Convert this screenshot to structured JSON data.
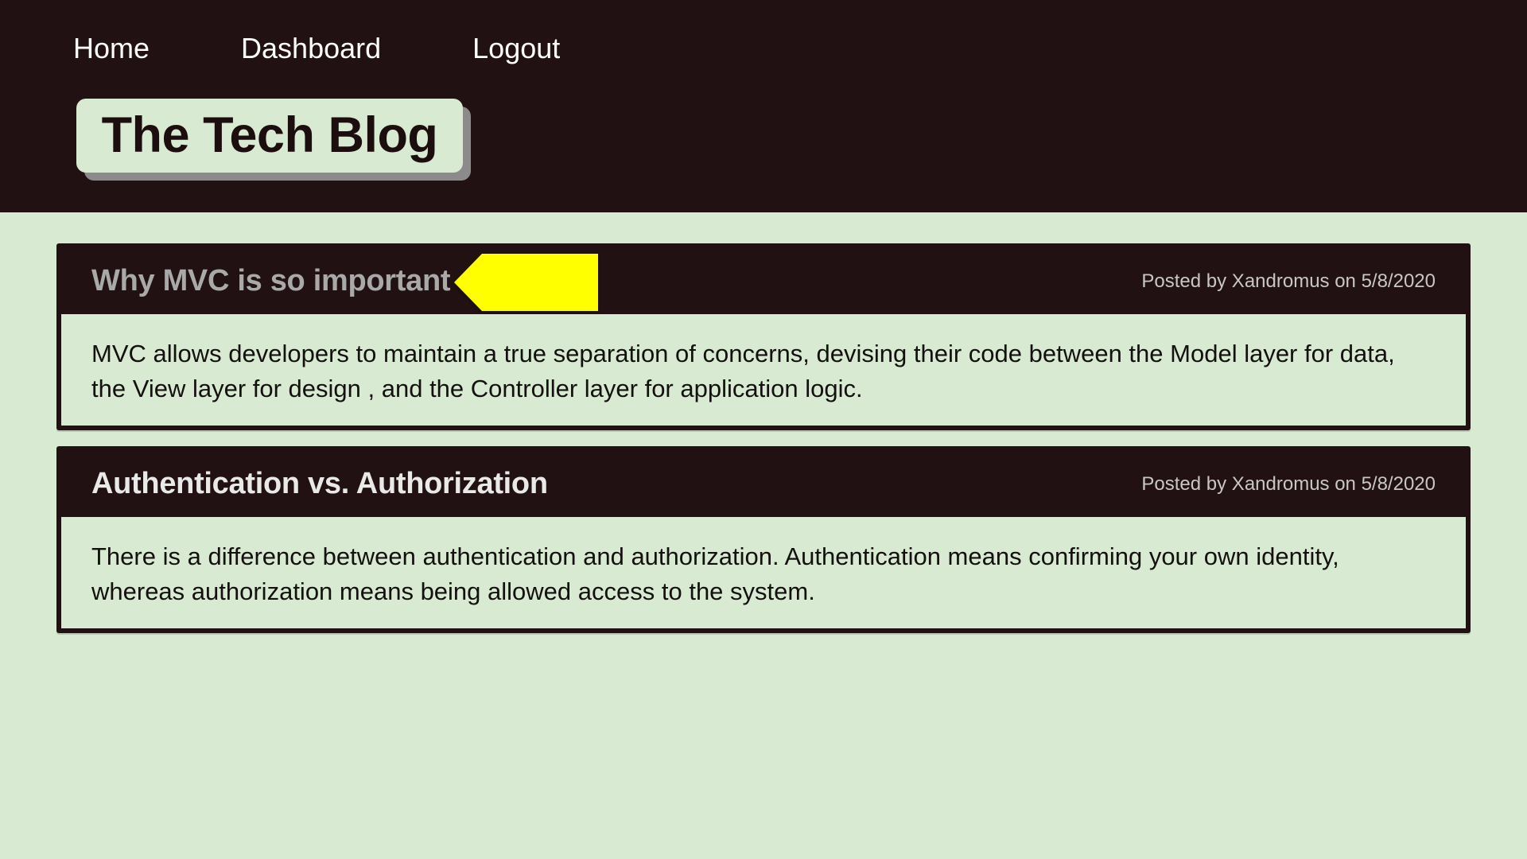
{
  "nav": {
    "items": [
      "Home",
      "Dashboard",
      "Logout"
    ]
  },
  "brand": {
    "title": "The Tech Blog"
  },
  "posts": [
    {
      "title": "Why MVC is so important",
      "meta": "Posted by Xandromus on 5/8/2020",
      "body": "MVC allows developers to maintain a true separation of concerns, devising their code between the Model layer for data, the View layer for design , and the Controller layer for application logic."
    },
    {
      "title": "Authentication vs. Authorization",
      "meta": "Posted by Xandromus on 5/8/2020",
      "body": "There is a difference between authentication and authorization. Authentication means confirming your own identity, whereas authorization means being allowed access to the system."
    }
  ],
  "colors": {
    "background": "#d8ead1",
    "header": "#221112",
    "marker": "#ffff00",
    "shadow": "#8c8a8a"
  }
}
